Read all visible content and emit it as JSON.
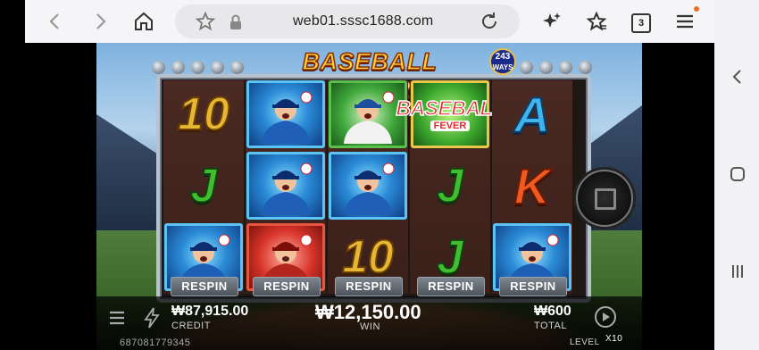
{
  "browser": {
    "url": "web01.sssc1688.com",
    "tab_count": "3",
    "notification_color": "#f26b21"
  },
  "game": {
    "title": "BASEBALL FEVER",
    "ways_badge": {
      "number": "243",
      "label": "WAYS"
    },
    "reels": [
      {
        "symbols": [
          "10",
          "J",
          "pitcher"
        ]
      },
      {
        "symbols": [
          "pitcher",
          "pitcher",
          "batter"
        ]
      },
      {
        "symbols": [
          "catcher",
          "pitcher",
          "10"
        ]
      },
      {
        "symbols": [
          "wild",
          "J",
          "J"
        ]
      },
      {
        "symbols": [
          "A",
          "K",
          "pitcher"
        ]
      }
    ],
    "wild_label": "BASEBALL",
    "wild_sub_label": "FEVER",
    "respin_label": "RESPIN",
    "credit": {
      "amount": "₩87,915.00",
      "label": "CREDIT"
    },
    "win": {
      "amount": "₩12,150.00",
      "label": "WIN"
    },
    "total": {
      "amount": "₩600",
      "label": "TOTAL"
    },
    "level": {
      "label": "LEVEL",
      "multiplier": "X10"
    },
    "session_id": "687081779345"
  }
}
